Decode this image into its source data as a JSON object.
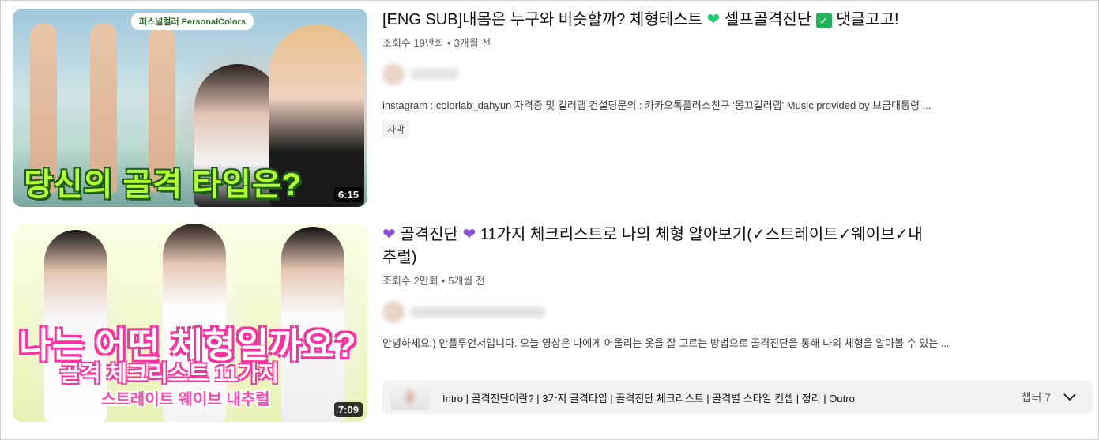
{
  "results": [
    {
      "thumb_tag": "퍼스널컬러 PersonalColors",
      "thumb_overlay": "당신의 골격 타입은?",
      "duration": "6:15",
      "title_parts": [
        "[ENG SUB]내몸은 누구와 비슷할까? 체형테스트",
        "셀프골격진단",
        "댓글고고!"
      ],
      "views": "조회수 19만회",
      "age": "3개월 전",
      "description": "instagram : colorlab_dahyun 자격증 및 컬러랩 컨설팅문의 : 카카오톡플러스친구 '몽끄컬러랩' Music provided by 브금대통령 ...",
      "badge": "자막"
    },
    {
      "thumb_overlay_lines": [
        "나는 어떤 체형일까요?",
        "골격 체크리스트 11가지",
        "스트레이트 웨이브 내추럴"
      ],
      "duration": "7:09",
      "title_parts": [
        "골격진단",
        "11가지 체크리스트로 나의 체형 알아보기(✓스트레이트✓웨이브✓내",
        "추럴)"
      ],
      "views": "조회수 2만회",
      "age": "5개월 전",
      "description": "안녕하세요:) 안플루언서입니다. 오늘 영상은 나에게 어울리는 옷을 잘 고르는 방법으로 골격진단을 통해 나의 체형을 알아볼 수 있는 ...",
      "chapters": {
        "text": "Intro | 골격진단이란? | 3가지 골격타입 | 골격진단 체크리스트 | 골격별 스타일 컨셉 | 정리 | Outro",
        "count": "챕터 7"
      }
    }
  ],
  "icons": {
    "heart": "green-heart-icon",
    "check": "check-mark-button-icon",
    "purple_heart": "purple-heart-icon",
    "chevron": "chevron-down-icon"
  },
  "colors": {
    "green_heart": "#1fcf6b",
    "check_bg": "#21b35c",
    "purple_heart": "#8a4fd8",
    "meta_text": "#606060"
  }
}
